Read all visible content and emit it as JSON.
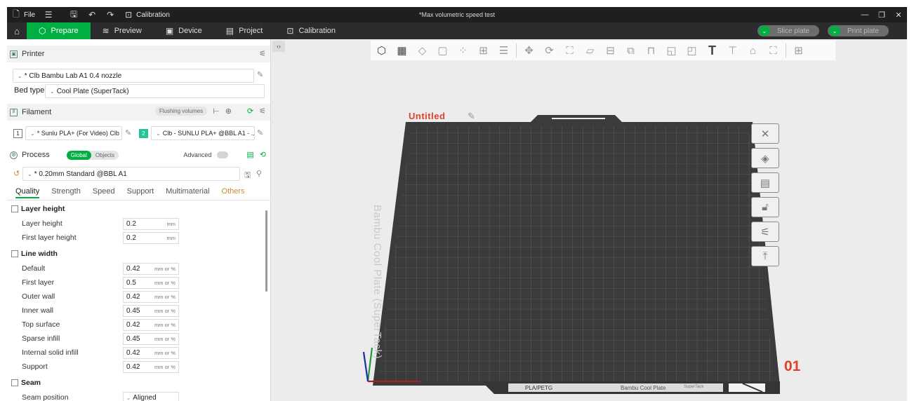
{
  "window": {
    "file_label": "File",
    "calibration_label": "Calibration",
    "title": "*Max volumetric speed test"
  },
  "nav": {
    "tabs": [
      {
        "label": "Prepare",
        "icon": "cube-icon",
        "active": true
      },
      {
        "label": "Preview",
        "icon": "layers-icon"
      },
      {
        "label": "Device",
        "icon": "device-icon"
      },
      {
        "label": "Project",
        "icon": "project-icon"
      },
      {
        "label": "Calibration",
        "icon": "calibration-icon"
      }
    ],
    "slice_plate": "Slice plate",
    "print_plate": "Print plate"
  },
  "printer": {
    "section_label": "Printer",
    "preset": "* Clb Bambu Lab A1 0.4 nozzle",
    "bed_type_label": "Bed type",
    "bed_type": "Cool Plate (SuperTack)"
  },
  "filament": {
    "section_label": "Filament",
    "flushing_label": "Flushing volumes",
    "slots": [
      {
        "num": "1",
        "name": "* Sunlu PLA+ (For Video) Clb",
        "color": "#ffffff"
      },
      {
        "num": "2",
        "name": "Clb - SUNLU PLA+ @BBL A1 - ...",
        "color": "#27c49a"
      }
    ]
  },
  "process": {
    "section_label": "Process",
    "global_label": "Global",
    "objects_label": "Objects",
    "advanced_label": "Advanced",
    "preset": "* 0.20mm Standard @BBL A1",
    "tabs": [
      "Quality",
      "Strength",
      "Speed",
      "Support",
      "Multimaterial",
      "Others"
    ],
    "groups": [
      {
        "title": "Layer height",
        "rows": [
          {
            "label": "Layer height",
            "value": "0.2",
            "unit": "mm"
          },
          {
            "label": "First layer height",
            "value": "0.2",
            "unit": "mm"
          }
        ]
      },
      {
        "title": "Line width",
        "rows": [
          {
            "label": "Default",
            "value": "0.42",
            "unit": "mm or %"
          },
          {
            "label": "First layer",
            "value": "0.5",
            "unit": "mm or %"
          },
          {
            "label": "Outer wall",
            "value": "0.42",
            "unit": "mm or %"
          },
          {
            "label": "Inner wall",
            "value": "0.45",
            "unit": "mm or %"
          },
          {
            "label": "Top surface",
            "value": "0.42",
            "unit": "mm or %"
          },
          {
            "label": "Sparse infill",
            "value": "0.45",
            "unit": "mm or %"
          },
          {
            "label": "Internal solid infill",
            "value": "0.42",
            "unit": "mm or %"
          },
          {
            "label": "Support",
            "value": "0.42",
            "unit": "mm or %"
          }
        ]
      },
      {
        "title": "Seam",
        "rows": [
          {
            "label": "Seam position",
            "value": "Aligned",
            "unit": ""
          }
        ]
      }
    ]
  },
  "viewport": {
    "plate_name": "Untitled",
    "plate_number": "01",
    "bed_text": "Bambu Cool Plate (SuperTack)",
    "bed_bottom_left": "PLA/PETG",
    "bed_bottom_right": "Bambu Cool Plate",
    "bed_bottom_right_small": "SuperTack"
  }
}
